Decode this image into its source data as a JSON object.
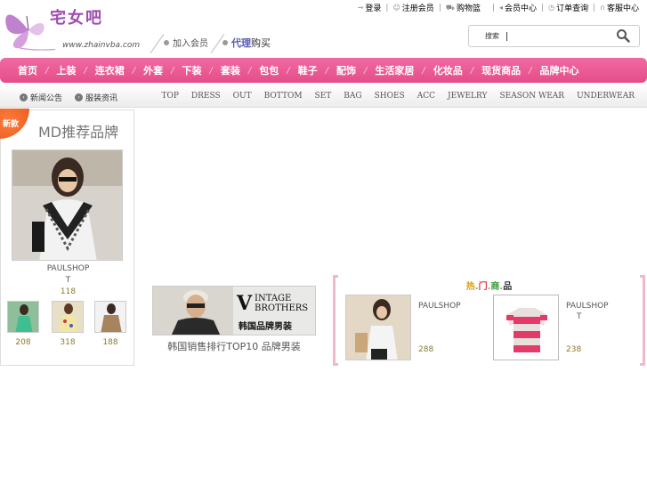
{
  "header": {
    "logo_cn": "宅女吧",
    "site_url": "www.zhainvba.com",
    "join_label": "加入会员",
    "agent_accent": "代理",
    "agent_rest": "购买",
    "top_links": [
      "登录",
      "注册会员",
      "购物篮",
      "会员中心",
      "订单查询",
      "客服中心"
    ],
    "search_label": "搜索",
    "search_value": "",
    "search_placeholder": ""
  },
  "main_nav": [
    "首页",
    "上装",
    "连衣裙",
    "外套",
    "下装",
    "套装",
    "包包",
    "鞋子",
    "配饰",
    "生活家居",
    "化妆品",
    "现货商品",
    "品牌中心"
  ],
  "sub_bar": {
    "news_label": "新闻公告",
    "fashion_label": "服装资讯",
    "categories": [
      "TOP",
      "DRESS",
      "OUT",
      "BOTTOM",
      "SET",
      "BAG",
      "SHOES",
      "ACC",
      "JEWELRY",
      "SEASON WEAR",
      "UNDERWEAR"
    ]
  },
  "md_panel": {
    "badge": "新款",
    "title": "MD推荐品牌",
    "main_brand": "PAULSHOP",
    "main_sub": "T",
    "main_price": "118",
    "thumbs": [
      {
        "price": "208"
      },
      {
        "price": "318"
      },
      {
        "price": "188"
      }
    ]
  },
  "banner": {
    "line1": "V",
    "line2a": "INTAGE",
    "line2b": "BROTHERS",
    "line3": "韩国品牌男装",
    "caption": "韩国销售排行TOP10 品牌男装"
  },
  "hot": {
    "title_parts": [
      "热",
      "门",
      "商",
      "品"
    ],
    "title_colors": [
      "#e0a000",
      "#d83a3a",
      "#3a9a3a",
      "#333333"
    ],
    "items": [
      {
        "brand": "PAULSHOP",
        "sub": "",
        "price": "288"
      },
      {
        "brand": "PAULSHOP",
        "sub": "T",
        "price": "238"
      }
    ]
  },
  "colors": {
    "nav_pink": "#e54d8a",
    "price_gold": "#8a7a2a",
    "bracket_pink": "#f1b8c9"
  }
}
